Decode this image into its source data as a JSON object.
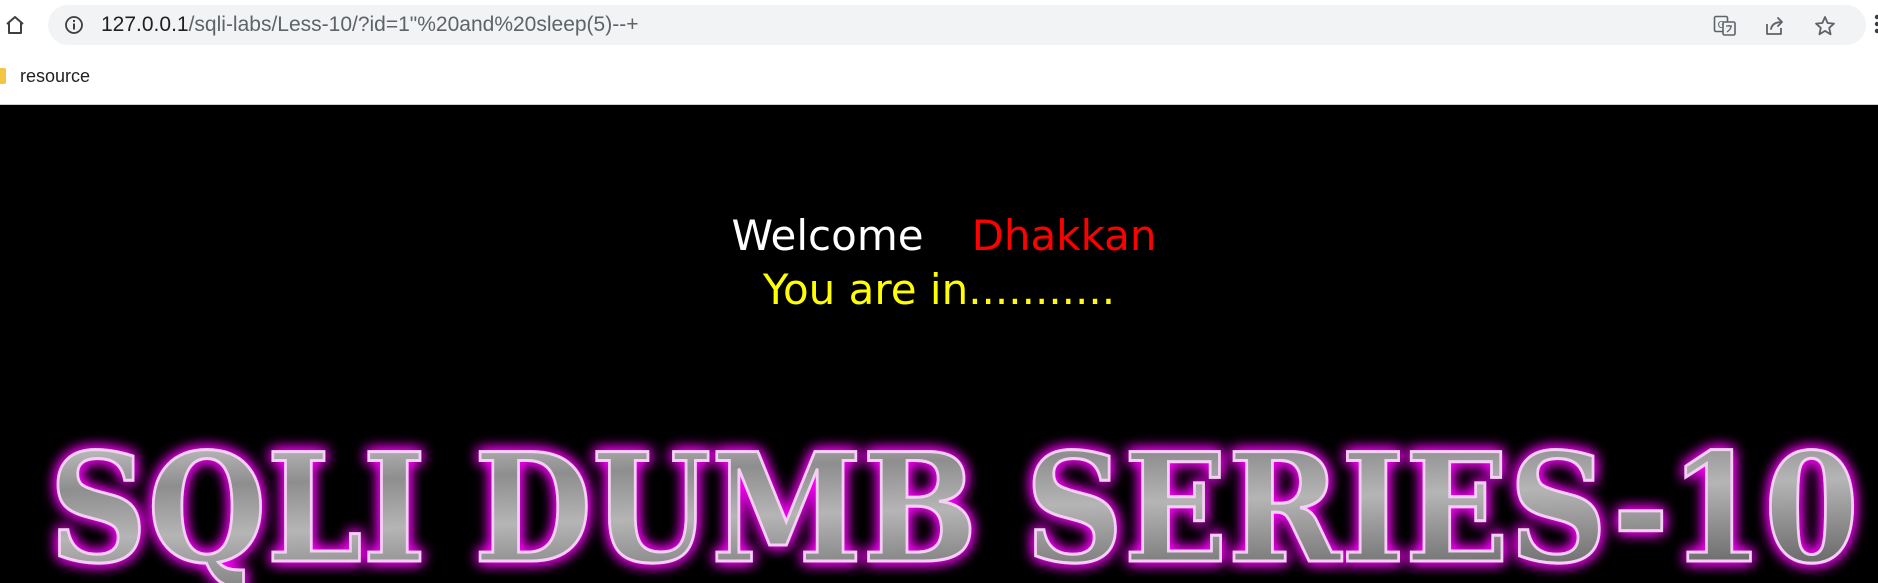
{
  "browser": {
    "url_host": "127.0.0.1",
    "url_rest": "/sqli-labs/Less-10/?id=1\"%20and%20sleep(5)--+",
    "home_icon": "home-icon",
    "info_icon": "info-icon",
    "action_icons": [
      "translate-icon",
      "share-icon",
      "star-icon"
    ],
    "bookmark_label": "resource"
  },
  "page": {
    "welcome_word": "Welcome",
    "welcome_name": "Dhakkan",
    "status_text": "You are in...........",
    "banner_text": "SQLI DUMB SERIES-10"
  },
  "colors": {
    "page_background": "#000000",
    "welcome_word": "#ffffff",
    "welcome_name": "#ff0000",
    "status_text": "#ffff00",
    "banner_glow": "#ff00ff",
    "banner_fill": "#9a9a9a"
  }
}
